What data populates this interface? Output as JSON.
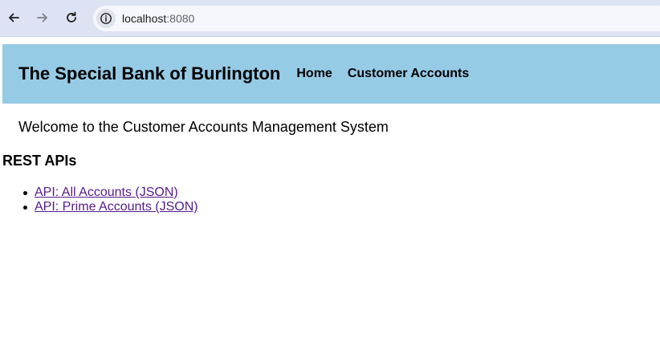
{
  "browser": {
    "url_host": "localhost",
    "url_port": ":8080",
    "icons": [
      "back-arrow-icon",
      "forward-arrow-icon",
      "reload-icon",
      "info-icon"
    ]
  },
  "header": {
    "brand": "The Special Bank of Burlington",
    "nav": {
      "home": "Home",
      "customer_accounts": "Customer Accounts"
    },
    "background_color": "#96cbe6"
  },
  "main": {
    "welcome": "Welcome to the Customer Accounts Management System",
    "rest_title": "REST APIs",
    "api_links": [
      "API: All Accounts (JSON)",
      "API: Prime Accounts (JSON)"
    ],
    "link_color": "#551a8b"
  }
}
